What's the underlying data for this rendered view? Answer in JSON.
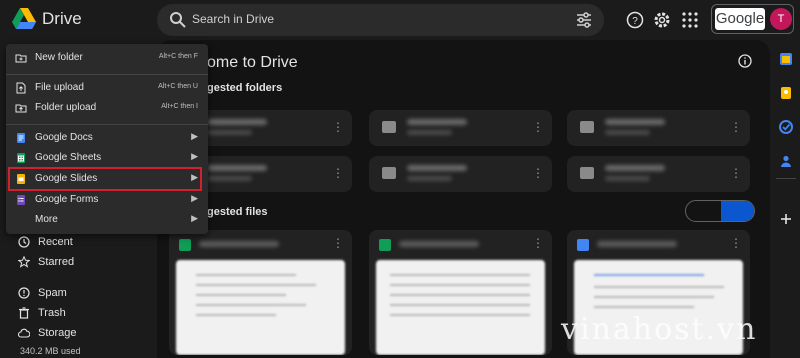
{
  "header": {
    "app_title": "Drive",
    "search_placeholder": "Search in Drive",
    "google_label": "Google",
    "avatar_initial": "T"
  },
  "new_menu": {
    "items": [
      {
        "label": "New folder",
        "shortcut": "Alt+C then F",
        "icon": "folder-plus-icon"
      },
      {
        "label": "File upload",
        "shortcut": "Alt+C then U",
        "icon": "file-upload-icon"
      },
      {
        "label": "Folder upload",
        "shortcut": "Alt+C then I",
        "icon": "folder-upload-icon"
      },
      {
        "label": "Google Docs",
        "icon": "google-docs-icon",
        "color": "#4285f4"
      },
      {
        "label": "Google Sheets",
        "icon": "google-sheets-icon",
        "color": "#0f9d58"
      },
      {
        "label": "Google Slides",
        "icon": "google-slides-icon",
        "color": "#f4b400",
        "highlighted": true
      },
      {
        "label": "Google Forms",
        "icon": "google-forms-icon",
        "color": "#7248b9"
      },
      {
        "label": "More"
      }
    ],
    "highlight_color": "#d3202f"
  },
  "nav": {
    "items": [
      {
        "label": "Recent",
        "icon": "clock-icon"
      },
      {
        "label": "Starred",
        "icon": "star-icon"
      },
      {
        "label": "Spam",
        "icon": "spam-icon"
      },
      {
        "label": "Trash",
        "icon": "trash-icon"
      },
      {
        "label": "Storage",
        "icon": "cloud-icon"
      }
    ],
    "storage_used": "340.2 MB used"
  },
  "main": {
    "welcome_title": "ome to Drive",
    "suggested_folders": "gested folders",
    "suggested_files": "gested files"
  },
  "watermark": "vinahost.vn",
  "colors": {
    "background": "#1b1b1b",
    "surface": "#2b2b2b",
    "accent": "#0b57d0"
  }
}
